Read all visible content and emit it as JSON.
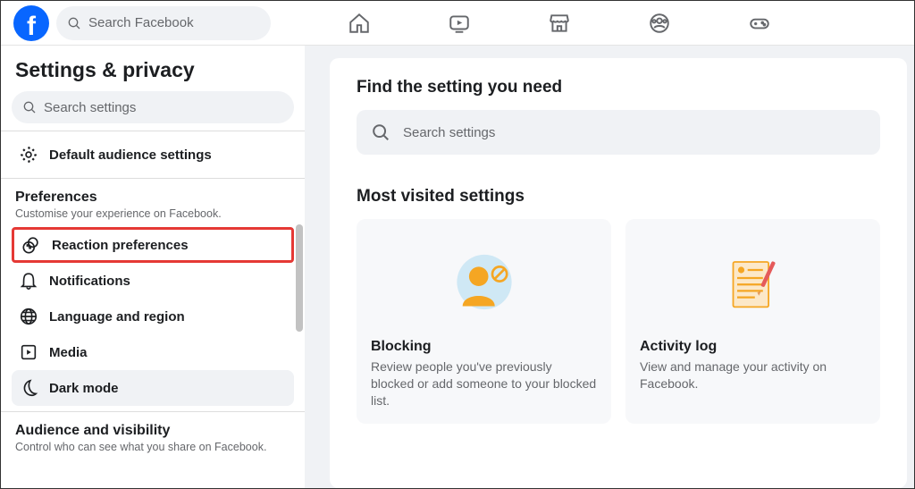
{
  "top": {
    "search_placeholder": "Search Facebook"
  },
  "sidebar": {
    "title": "Settings & privacy",
    "search_placeholder": "Search settings",
    "default_audience": "Default audience settings",
    "preferences_title": "Preferences",
    "preferences_sub": "Customise your experience on Facebook.",
    "items": {
      "reaction": "Reaction preferences",
      "notifications": "Notifications",
      "language": "Language and region",
      "media": "Media",
      "darkmode": "Dark mode"
    },
    "audience_title": "Audience and visibility",
    "audience_sub": "Control who can see what you share on Facebook."
  },
  "main": {
    "find_title": "Find the setting you need",
    "search_placeholder": "Search settings",
    "most_visited_title": "Most visited settings",
    "cards": {
      "blocking": {
        "title": "Blocking",
        "desc": "Review people you've previously blocked or add someone to your blocked list."
      },
      "activity": {
        "title": "Activity log",
        "desc": "View and manage your activity on Facebook."
      }
    }
  }
}
